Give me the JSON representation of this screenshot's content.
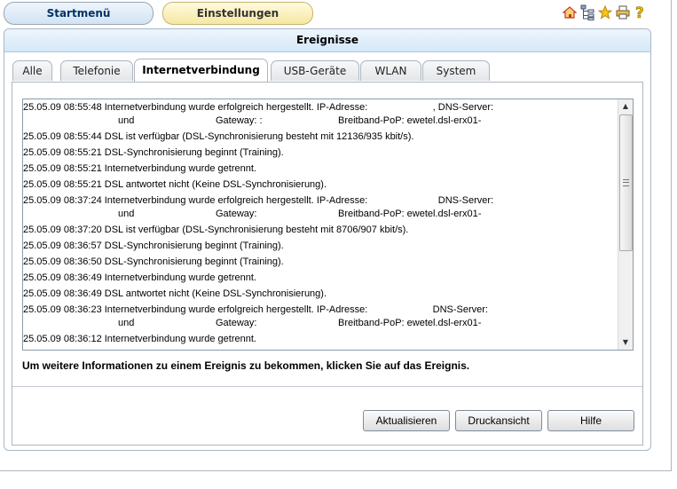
{
  "nav": {
    "start_label": "Startmenü",
    "settings_label": "Einstellungen"
  },
  "top_icons": [
    "home-icon",
    "sitemap-icon",
    "star-icon",
    "printer-icon",
    "help-icon"
  ],
  "panel": {
    "title": "Ereignisse"
  },
  "tabs": [
    {
      "label": "Alle"
    },
    {
      "label": "Telefonie"
    },
    {
      "label": "Internetverbindung",
      "active": true
    },
    {
      "label": "USB-Geräte"
    },
    {
      "label": "WLAN"
    },
    {
      "label": "System"
    }
  ],
  "events": [
    {
      "text": "25.05.09 08:55:48 Internetverbindung wurde erfolgreich hergestellt. IP-Adresse:                        , DNS-Server:",
      "line2": [
        "und",
        "Gateway: :",
        "Breitband-PoP: ewetel.dsl-erx01-"
      ]
    },
    {
      "text": "25.05.09 08:55:44 DSL ist verfügbar (DSL-Synchronisierung besteht mit 12136/935 kbit/s)."
    },
    {
      "text": "25.05.09 08:55:21 DSL-Synchronisierung beginnt (Training)."
    },
    {
      "text": "25.05.09 08:55:21 Internetverbindung wurde getrennt."
    },
    {
      "text": "25.05.09 08:55:21 DSL antwortet nicht (Keine DSL-Synchronisierung)."
    },
    {
      "text": "25.05.09 08:37:24 Internetverbindung wurde erfolgreich hergestellt. IP-Adresse:                          DNS-Server:",
      "line2": [
        "und",
        "Gateway:",
        "Breitband-PoP: ewetel.dsl-erx01-"
      ]
    },
    {
      "text": "25.05.09 08:37:20 DSL ist verfügbar (DSL-Synchronisierung besteht mit 8706/907 kbit/s)."
    },
    {
      "text": "25.05.09 08:36:57 DSL-Synchronisierung beginnt (Training)."
    },
    {
      "text": "25.05.09 08:36:50 DSL-Synchronisierung beginnt (Training)."
    },
    {
      "text": "25.05.09 08:36:49 Internetverbindung wurde getrennt."
    },
    {
      "text": "25.05.09 08:36:49 DSL antwortet nicht (Keine DSL-Synchronisierung)."
    },
    {
      "text": "25.05.09 08:36:23 Internetverbindung wurde erfolgreich hergestellt. IP-Adresse:                        DNS-Server:",
      "line2": [
        "und",
        "Gateway:",
        "Breitband-PoP: ewetel.dsl-erx01-"
      ]
    },
    {
      "text": "25.05.09 08:36:12 Internetverbindung wurde getrennt."
    }
  ],
  "hint": "Um weitere Informationen zu einem Ereignis zu bekommen, klicken Sie auf das Ereignis.",
  "buttons": {
    "refresh": "Aktualisieren",
    "print": "Druckansicht",
    "help": "Hilfe"
  }
}
